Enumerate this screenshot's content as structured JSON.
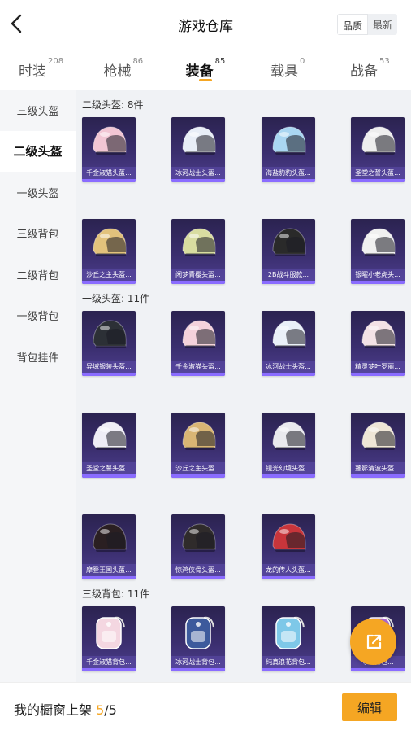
{
  "header": {
    "title": "游戏仓库",
    "sort_quality": "品质",
    "sort_latest": "最新"
  },
  "tabs": [
    {
      "label": "时装",
      "count": "208"
    },
    {
      "label": "枪械",
      "count": "86"
    },
    {
      "label": "装备",
      "count": "85"
    },
    {
      "label": "载具",
      "count": "0"
    },
    {
      "label": "战备",
      "count": "53"
    }
  ],
  "active_tab": "装备",
  "sidebar": {
    "items": [
      "三级头盔",
      "二级头盔",
      "一级头盔",
      "三级背包",
      "二级背包",
      "一级背包",
      "背包挂件"
    ],
    "active": "二级头盔"
  },
  "sections": [
    {
      "title": "二级头盔: 8件",
      "items": [
        {
          "name": "千金淑猫头盔...",
          "icon": "pink-cat-helmet-icon",
          "color": "#f2c6d4"
        },
        {
          "name": "冰河战士头盔...",
          "icon": "white-blue-helmet-icon",
          "color": "#e8eef7"
        },
        {
          "name": "海盐豹豹头盔...",
          "icon": "leopard-helmet-icon",
          "color": "#a9d6f2"
        },
        {
          "name": "圣堂之誓头盔...",
          "icon": "winged-helmet-icon",
          "color": "#eee"
        },
        {
          "name": "沙丘之主头盔...",
          "icon": "gold-helmet-icon",
          "color": "#e2c27c"
        },
        {
          "name": "闲梦青樱头盔...",
          "icon": "green-helmet-icon",
          "color": "#d8dca0"
        },
        {
          "name": "2B战斗服款...",
          "icon": "black-helmet-icon",
          "color": "#2a2a2a"
        },
        {
          "name": "银曜小老虎头...",
          "icon": "tiger-helmet-icon",
          "color": "#f0f0f0"
        }
      ]
    },
    {
      "title": "一级头盔: 11件",
      "items": [
        {
          "name": "异域银装头盔...",
          "icon": "black-cyan-helmet-icon",
          "color": "#2c3036"
        },
        {
          "name": "千金淑猫头盔...",
          "icon": "pink-helmet-icon",
          "color": "#f4d2db"
        },
        {
          "name": "冰河战士头盔...",
          "icon": "white-blue-moto-helmet-icon",
          "color": "#eaf0f8"
        },
        {
          "name": "精灵梦叶罗丽...",
          "icon": "pink-moto-helmet-icon",
          "color": "#f3e2e6"
        },
        {
          "name": "圣堂之誓头盔...",
          "icon": "white-purple-helmet-icon",
          "color": "#efeef6"
        },
        {
          "name": "沙丘之主头盔...",
          "icon": "tan-moto-helmet-icon",
          "color": "#d9b574"
        },
        {
          "name": "镜光幻境头盔...",
          "icon": "silver-helmet-icon",
          "color": "#e9e9ee"
        },
        {
          "name": "蓬影清波头盔...",
          "icon": "cream-helmet-icon",
          "color": "#efe6d6"
        },
        {
          "name": "摩登王国头盔...",
          "icon": "red-visor-helmet-icon",
          "color": "#2a1f22"
        },
        {
          "name": "惊鸿侠骨头盔...",
          "icon": "dark-helmet-icon",
          "color": "#2f2b2b"
        },
        {
          "name": "龙的传人头盔...",
          "icon": "red-gold-helmet-icon",
          "color": "#c8353b"
        }
      ]
    },
    {
      "title": "三级背包: 11件",
      "items": [
        {
          "name": "千金淑猫背包...",
          "icon": "pink-cat-backpack-icon",
          "color": "#f4d7e1"
        },
        {
          "name": "冰河战士背包...",
          "icon": "blue-backpack-icon",
          "color": "#3d5a9c"
        },
        {
          "name": "纯真浪花背包...",
          "icon": "drink-backpack-icon",
          "color": "#7ec8e8"
        },
        {
          "name": "守...背包...",
          "icon": "backpack-icon",
          "color": "#b06bd0"
        }
      ]
    }
  ],
  "bottom": {
    "caption": "我的橱窗上架 ",
    "current": "5",
    "separator": "/",
    "total": "5",
    "edit": "编辑"
  }
}
